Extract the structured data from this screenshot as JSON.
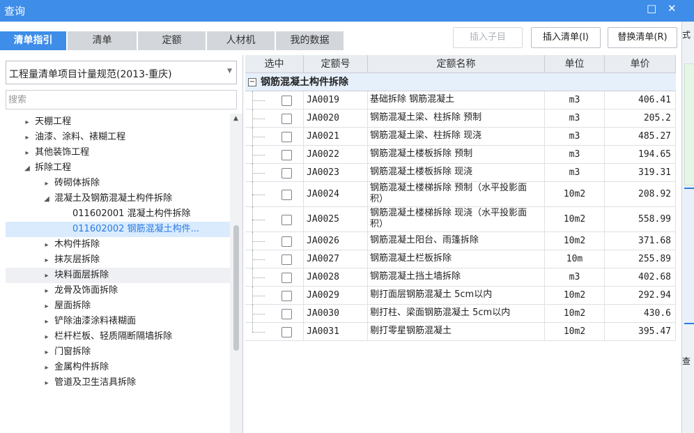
{
  "window": {
    "title": "查询",
    "min_glyph": "□",
    "close_glyph": "✕"
  },
  "right_strip": {
    "t1": "式",
    "t2": "查"
  },
  "tabs": [
    "清单指引",
    "清单",
    "定额",
    "人材机",
    "我的数据"
  ],
  "toolbar": {
    "insert_child": "插入子目",
    "insert_list": "插入清单(I)",
    "replace_list": "替换清单(R)"
  },
  "left": {
    "spec_select": "工程量清单项目计量规范(2013-重庆)",
    "search_placeholder": "搜索",
    "tree": [
      {
        "indent": 1,
        "exp": "▸",
        "label": "天棚工程"
      },
      {
        "indent": 1,
        "exp": "▸",
        "label": "油漆、涂料、裱糊工程"
      },
      {
        "indent": 1,
        "exp": "▸",
        "label": "其他装饰工程"
      },
      {
        "indent": 1,
        "exp": "◢",
        "label": "拆除工程"
      },
      {
        "indent": 2,
        "exp": "▸",
        "label": "砖砌体拆除"
      },
      {
        "indent": 2,
        "exp": "◢",
        "label": "混凝土及钢筋混凝土构件拆除"
      },
      {
        "indent": 3,
        "exp": "",
        "label": "011602001  混凝土构件拆除"
      },
      {
        "indent": 3,
        "exp": "",
        "label": "011602002  钢筋混凝土构件...",
        "selected": true
      },
      {
        "indent": 2,
        "exp": "▸",
        "label": "木构件拆除"
      },
      {
        "indent": 2,
        "exp": "▸",
        "label": "抹灰层拆除"
      },
      {
        "indent": 2,
        "exp": "▸",
        "label": "块料面层拆除",
        "hover": true
      },
      {
        "indent": 2,
        "exp": "▸",
        "label": "龙骨及饰面拆除"
      },
      {
        "indent": 2,
        "exp": "▸",
        "label": "屋面拆除"
      },
      {
        "indent": 2,
        "exp": "▸",
        "label": "铲除油漆涂料裱糊面"
      },
      {
        "indent": 2,
        "exp": "▸",
        "label": "栏杆栏板、轻质隔断隔墙拆除"
      },
      {
        "indent": 2,
        "exp": "▸",
        "label": "门窗拆除"
      },
      {
        "indent": 2,
        "exp": "▸",
        "label": "金属构件拆除"
      },
      {
        "indent": 2,
        "exp": "▸",
        "label": "管道及卫生洁具拆除"
      }
    ]
  },
  "grid": {
    "headers": [
      "选中",
      "定额号",
      "定额名称",
      "单位",
      "单价"
    ],
    "group_label": "钢筋混凝土构件拆除",
    "group_toggle": "−",
    "rows": [
      {
        "code": "JA0019",
        "name": "基础拆除 钢筋混凝土",
        "unit": "m3",
        "price": "406.41"
      },
      {
        "code": "JA0020",
        "name": "钢筋混凝土梁、柱拆除 预制",
        "unit": "m3",
        "price": "205.2"
      },
      {
        "code": "JA0021",
        "name": "钢筋混凝土梁、柱拆除 现浇",
        "unit": "m3",
        "price": "485.27"
      },
      {
        "code": "JA0022",
        "name": "钢筋混凝土楼板拆除 预制",
        "unit": "m3",
        "price": "194.65"
      },
      {
        "code": "JA0023",
        "name": "钢筋混凝土楼板拆除 现浇",
        "unit": "m3",
        "price": "319.31"
      },
      {
        "code": "JA0024",
        "name": "钢筋混凝土楼梯拆除 预制（水平投影面积）",
        "unit": "10m2",
        "price": "208.92",
        "tall": true
      },
      {
        "code": "JA0025",
        "name": "钢筋混凝土楼梯拆除 现浇（水平投影面积）",
        "unit": "10m2",
        "price": "558.99",
        "tall": true
      },
      {
        "code": "JA0026",
        "name": "钢筋混凝土阳台、雨篷拆除",
        "unit": "10m2",
        "price": "371.68"
      },
      {
        "code": "JA0027",
        "name": "钢筋混凝土栏板拆除",
        "unit": "10m",
        "price": "255.89"
      },
      {
        "code": "JA0028",
        "name": "钢筋混凝土挡土墙拆除",
        "unit": "m3",
        "price": "402.68"
      },
      {
        "code": "JA0029",
        "name": "剔打面层钢筋混凝土 5cm以内",
        "unit": "10m2",
        "price": "292.94"
      },
      {
        "code": "JA0030",
        "name": "剔打柱、梁面钢筋混凝土 5cm以内",
        "unit": "10m2",
        "price": "430.6"
      },
      {
        "code": "JA0031",
        "name": "剔打零星钢筋混凝土",
        "unit": "10m2",
        "price": "395.47"
      }
    ]
  }
}
